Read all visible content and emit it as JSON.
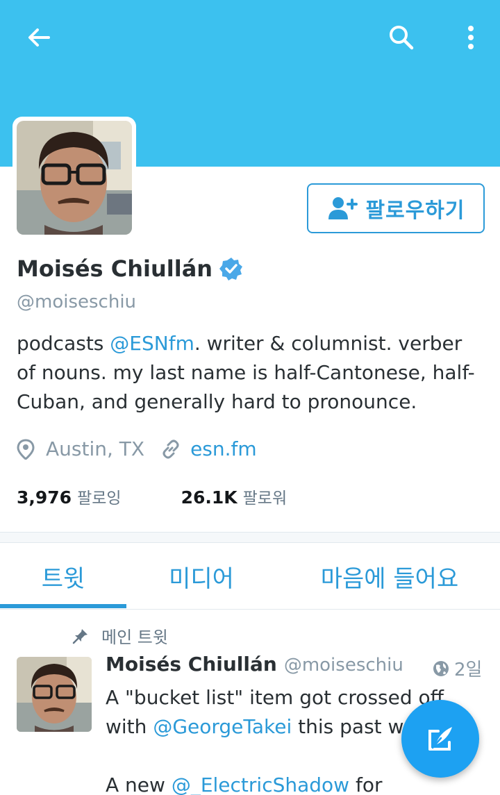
{
  "header": {
    "accent_color": "#3cc1ef",
    "back_icon": "arrow-left-icon",
    "search_icon": "search-icon",
    "more_icon": "more-vertical-icon"
  },
  "profile": {
    "follow_label": "팔로우하기",
    "name": "Moisés Chiullán",
    "verified": true,
    "handle": "@moiseschiu",
    "bio": {
      "before": "podcasts ",
      "mention": "@ESNfm",
      "after_line1": ". writer & columnist. verber",
      "line2": "of nouns. my last name is half-Cantonese, half-",
      "line3": "Cuban, and generally hard to pronounce."
    },
    "location": "Austin, TX",
    "website": "esn.fm",
    "stats": {
      "following_count": "3,976",
      "following_label": "팔로잉",
      "followers_count": "26.1K",
      "followers_label": "팔로워"
    }
  },
  "tabs": [
    {
      "label": "트윗",
      "active": true
    },
    {
      "label": "미디어",
      "active": false
    },
    {
      "label": "마음에 들어요",
      "active": false
    }
  ],
  "pinned_tweet": {
    "pinned_label": "메인 트윗",
    "name": "Moisés Chiullán",
    "handle": "@moiseschiu",
    "time": "2일",
    "line1": "A \"bucket list\" item got crossed off",
    "line2_before": "with ",
    "line2_mention": "@GeorgeTakei",
    "line2_after": " this past w",
    "line4_before": "A new ",
    "line4_mention": "@_ElectricShadow",
    "line4_after": " for"
  },
  "compose_fab": {
    "icon": "compose-icon",
    "color": "#1da1f2"
  }
}
